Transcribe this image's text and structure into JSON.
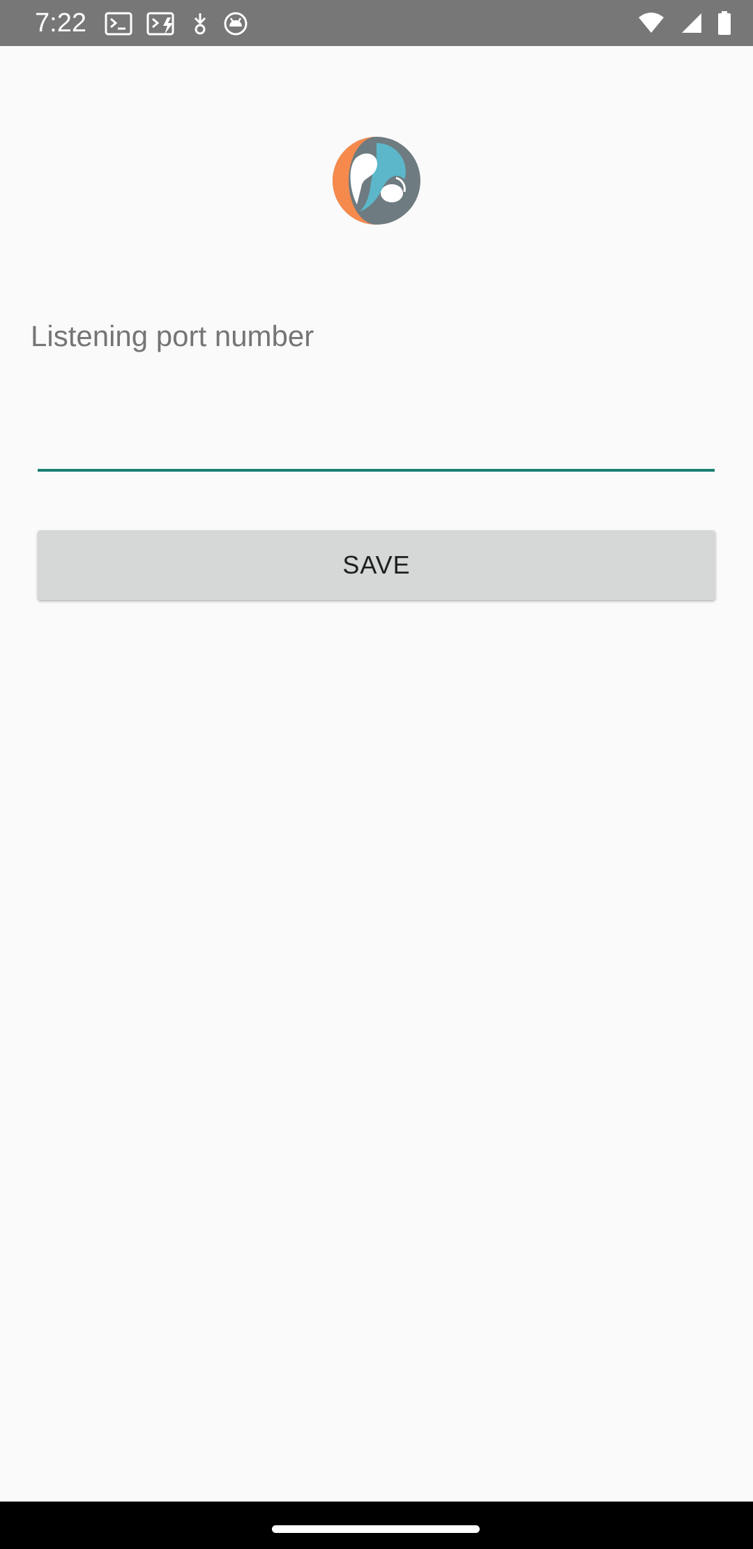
{
  "status_bar": {
    "time": "7:22",
    "left_icons": [
      "terminal-icon",
      "terminal-bolt-icon",
      "download-icon",
      "android-icon"
    ],
    "right_icons": [
      "wifi-icon",
      "signal-icon",
      "battery-icon"
    ]
  },
  "form": {
    "label": "Listening port number",
    "port_value": "",
    "save_label": "SAVE"
  },
  "colors": {
    "accent": "#1a7f74",
    "button_bg": "#d6d7d7",
    "status_bar_bg": "#777777",
    "logo_orange": "#f68a4c",
    "logo_teal": "#5bb7c9",
    "logo_gray": "#6e7b80"
  }
}
